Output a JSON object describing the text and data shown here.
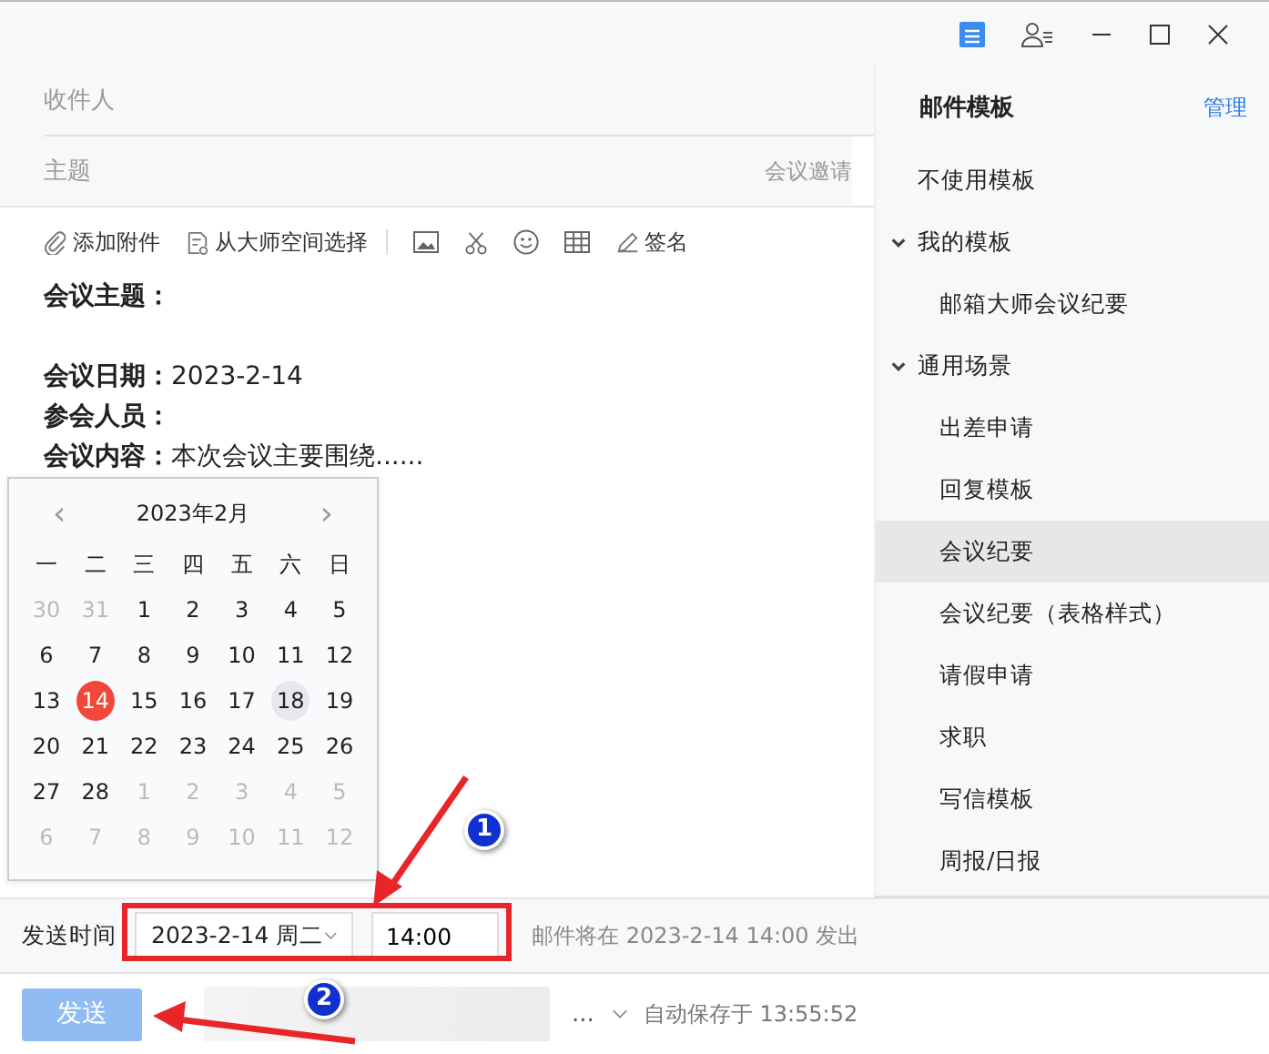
{
  "compose": {
    "recipient_placeholder": "收件人",
    "subject_placeholder": "主题",
    "subject_hint": "会议邀请"
  },
  "toolbar": [
    {
      "kind": "attach",
      "label": "添加附件"
    },
    {
      "kind": "master",
      "label": "从大师空间选择"
    },
    {
      "kind": "image"
    },
    {
      "kind": "cut"
    },
    {
      "kind": "emoji"
    },
    {
      "kind": "table"
    },
    {
      "kind": "signature",
      "label": "签名"
    }
  ],
  "body": [
    {
      "kind": "field",
      "label": "会议主题："
    },
    {
      "kind": "blank"
    },
    {
      "kind": "field",
      "label": "会议日期：",
      "value": "2023-2-14"
    },
    {
      "kind": "field",
      "label": "参会人员："
    },
    {
      "kind": "field",
      "label": "会议内容：",
      "value": "本次会议主要围绕......"
    }
  ],
  "calendar": {
    "prev": "‹",
    "title": "2023年2月",
    "next": "›",
    "weekdays": [
      "一",
      "二",
      "三",
      "四",
      "五",
      "六",
      "日"
    ],
    "weeks": [
      [
        {
          "day": "30",
          "in_month": false,
          "selected": false,
          "today": false
        },
        {
          "day": "31",
          "in_month": false,
          "selected": false,
          "today": false
        },
        {
          "day": "1",
          "in_month": true,
          "selected": false,
          "today": false
        },
        {
          "day": "2",
          "in_month": true,
          "selected": false,
          "today": false
        },
        {
          "day": "3",
          "in_month": true,
          "selected": false,
          "today": false
        },
        {
          "day": "4",
          "in_month": true,
          "selected": false,
          "today": false
        },
        {
          "day": "5",
          "in_month": true,
          "selected": false,
          "today": false
        }
      ],
      [
        {
          "day": "6",
          "in_month": true,
          "selected": false,
          "today": false
        },
        {
          "day": "7",
          "in_month": true,
          "selected": false,
          "today": false
        },
        {
          "day": "8",
          "in_month": true,
          "selected": false,
          "today": false
        },
        {
          "day": "9",
          "in_month": true,
          "selected": false,
          "today": false
        },
        {
          "day": "10",
          "in_month": true,
          "selected": false,
          "today": false
        },
        {
          "day": "11",
          "in_month": true,
          "selected": false,
          "today": false
        },
        {
          "day": "12",
          "in_month": true,
          "selected": false,
          "today": false
        }
      ],
      [
        {
          "day": "13",
          "in_month": true,
          "selected": false,
          "today": false
        },
        {
          "day": "14",
          "in_month": true,
          "selected": true,
          "today": false
        },
        {
          "day": "15",
          "in_month": true,
          "selected": false,
          "today": false
        },
        {
          "day": "16",
          "in_month": true,
          "selected": false,
          "today": false
        },
        {
          "day": "17",
          "in_month": true,
          "selected": false,
          "today": false
        },
        {
          "day": "18",
          "in_month": true,
          "selected": false,
          "today": true
        },
        {
          "day": "19",
          "in_month": true,
          "selected": false,
          "today": false
        }
      ],
      [
        {
          "day": "20",
          "in_month": true,
          "selected": false,
          "today": false
        },
        {
          "day": "21",
          "in_month": true,
          "selected": false,
          "today": false
        },
        {
          "day": "22",
          "in_month": true,
          "selected": false,
          "today": false
        },
        {
          "day": "23",
          "in_month": true,
          "selected": false,
          "today": false
        },
        {
          "day": "24",
          "in_month": true,
          "selected": false,
          "today": false
        },
        {
          "day": "25",
          "in_month": true,
          "selected": false,
          "today": false
        },
        {
          "day": "26",
          "in_month": true,
          "selected": false,
          "today": false
        }
      ],
      [
        {
          "day": "27",
          "in_month": true,
          "selected": false,
          "today": false
        },
        {
          "day": "28",
          "in_month": true,
          "selected": false,
          "today": false
        },
        {
          "day": "1",
          "in_month": false,
          "selected": false,
          "today": false
        },
        {
          "day": "2",
          "in_month": false,
          "selected": false,
          "today": false
        },
        {
          "day": "3",
          "in_month": false,
          "selected": false,
          "today": false
        },
        {
          "day": "4",
          "in_month": false,
          "selected": false,
          "today": false
        },
        {
          "day": "5",
          "in_month": false,
          "selected": false,
          "today": false
        }
      ],
      [
        {
          "day": "6",
          "in_month": false,
          "selected": false,
          "today": false
        },
        {
          "day": "7",
          "in_month": false,
          "selected": false,
          "today": false
        },
        {
          "day": "8",
          "in_month": false,
          "selected": false,
          "today": false
        },
        {
          "day": "9",
          "in_month": false,
          "selected": false,
          "today": false
        },
        {
          "day": "10",
          "in_month": false,
          "selected": false,
          "today": false
        },
        {
          "day": "11",
          "in_month": false,
          "selected": false,
          "today": false
        },
        {
          "day": "12",
          "in_month": false,
          "selected": false,
          "today": false
        }
      ]
    ]
  },
  "schedule": {
    "label": "发送时间",
    "date": "2023-2-14 周二",
    "time": "14:00",
    "note": "邮件将在 2023-2-14 14:00 发出"
  },
  "footer": {
    "send": "发送",
    "send_disabled": true,
    "more": "...",
    "autosave": "自动保存于 13:55:52"
  },
  "sidebar": {
    "title": "邮件模板",
    "manage": "管理",
    "items": [
      {
        "label": "不使用模板",
        "selected": false
      },
      {
        "label": "我的模板",
        "selected": false,
        "expanded": true,
        "children": [
          {
            "label": "邮箱大师会议纪要",
            "selected": false
          }
        ]
      },
      {
        "label": "通用场景",
        "selected": false,
        "expanded": true,
        "children": [
          {
            "label": "出差申请",
            "selected": false
          },
          {
            "label": "回复模板",
            "selected": false
          },
          {
            "label": "会议纪要",
            "selected": true
          },
          {
            "label": "会议纪要（表格样式）",
            "selected": false
          },
          {
            "label": "请假申请",
            "selected": false
          },
          {
            "label": "求职",
            "selected": false
          },
          {
            "label": "写信模板",
            "selected": false
          },
          {
            "label": "周报/日报",
            "selected": false
          }
        ]
      }
    ]
  },
  "annotations": [
    {
      "label": "1"
    },
    {
      "label": "2"
    }
  ]
}
